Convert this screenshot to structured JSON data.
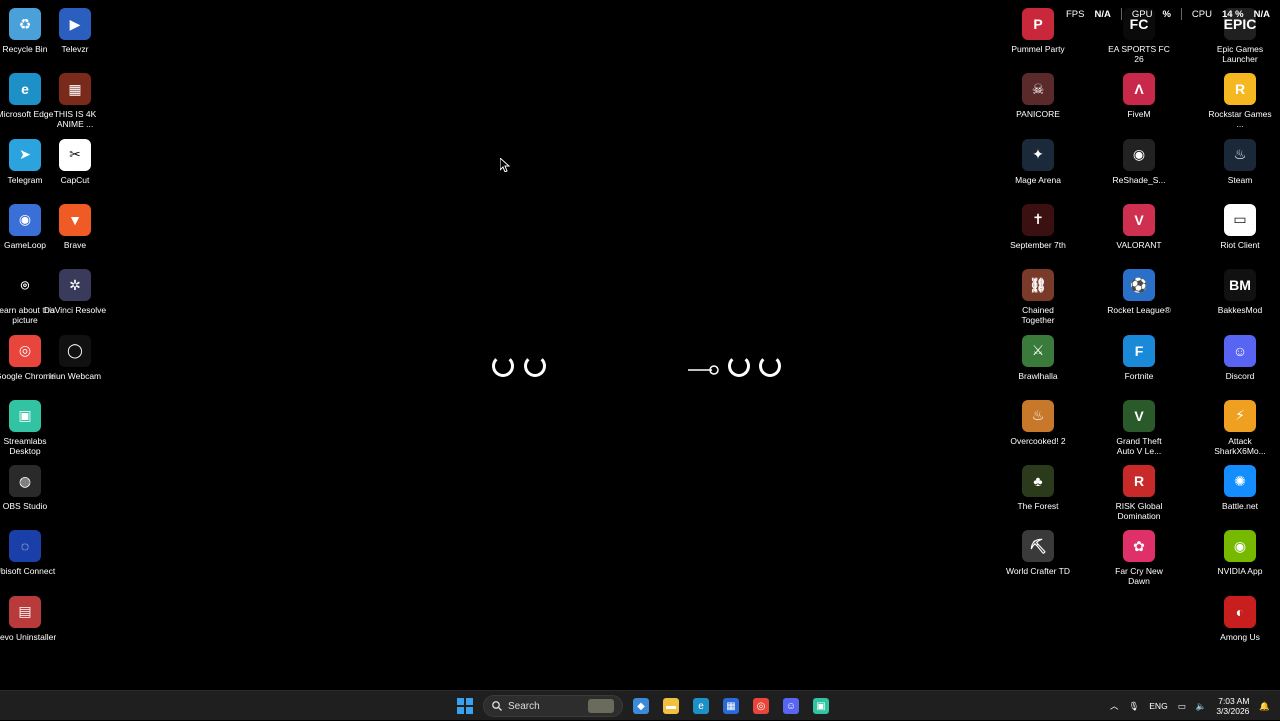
{
  "desktop": {
    "left_icons": [
      {
        "name": "recycle-bin",
        "label": "Recycle Bin",
        "color": "#4aa0d8",
        "glyph": "♻"
      },
      {
        "name": "televzr",
        "label": "Televzr",
        "color": "#2a5fbf",
        "glyph": "▶"
      },
      {
        "name": "microsoft-edge",
        "label": "Microsoft Edge",
        "color": "#1e90c8",
        "glyph": "e"
      },
      {
        "name": "this-is-4k-anime",
        "label": "THIS IS 4K ANIME ...",
        "color": "#7a2a1a",
        "glyph": "▦"
      },
      {
        "name": "telegram",
        "label": "Telegram",
        "color": "#2aa3df",
        "glyph": "➤"
      },
      {
        "name": "capcut",
        "label": "CapCut",
        "color": "#ffffff",
        "glyph": "✂"
      },
      {
        "name": "gameloop",
        "label": "GameLoop",
        "color": "#3a6fd8",
        "glyph": "◉"
      },
      {
        "name": "brave",
        "label": "Brave",
        "color": "#f05a24",
        "glyph": "▼"
      },
      {
        "name": "learn-about-picture",
        "label": "Learn about this picture",
        "color": "#000000",
        "glyph": "⌾"
      },
      {
        "name": "davinci-resolve",
        "label": "DaVinci Resolve",
        "color": "#3a3a5a",
        "glyph": "✲"
      },
      {
        "name": "google-chrome",
        "label": "Google Chrome",
        "color": "#e8453c",
        "glyph": "◎"
      },
      {
        "name": "iriun-webcam",
        "label": "Iriun Webcam",
        "color": "#111111",
        "glyph": "◯"
      },
      {
        "name": "streamlabs-desktop",
        "label": "Streamlabs Desktop",
        "color": "#31c3a2",
        "glyph": "▣"
      },
      {
        "name": "obs-studio",
        "label": "OBS Studio",
        "color": "#2a2a2a",
        "glyph": "◍"
      },
      {
        "name": "ubisoft-connect",
        "label": "Ubisoft Connect",
        "color": "#1a3fa8",
        "glyph": "◌"
      },
      {
        "name": "revo-uninstaller",
        "label": "Revo Uninstaller",
        "color": "#b83a3a",
        "glyph": "▤"
      }
    ],
    "right_icons": [
      {
        "name": "pummel-party",
        "label": "Pummel Party",
        "color": "#c8283a",
        "glyph": "P"
      },
      {
        "name": "ea-sports-fc-26",
        "label": "EA SPORTS FC 26",
        "color": "#0a0a0a",
        "glyph": "FC"
      },
      {
        "name": "epic-games-launcher",
        "label": "Epic Games Launcher",
        "color": "#202020",
        "glyph": "EPIC"
      },
      {
        "name": "panicore",
        "label": "PANICORE",
        "color": "#5a2a2a",
        "glyph": "☠"
      },
      {
        "name": "fivem",
        "label": "FiveM",
        "color": "#c8284a",
        "glyph": "Λ"
      },
      {
        "name": "rockstar-games",
        "label": "Rockstar Games ...",
        "color": "#f6b820",
        "glyph": "R"
      },
      {
        "name": "mage-arena",
        "label": "Mage Arena",
        "color": "#1a2a3a",
        "glyph": "✦"
      },
      {
        "name": "reshade",
        "label": "ReShade_S...",
        "color": "#222222",
        "glyph": "◉"
      },
      {
        "name": "steam",
        "label": "Steam",
        "color": "#1b2838",
        "glyph": "♨"
      },
      {
        "name": "september-7th",
        "label": "September 7th",
        "color": "#3a1010",
        "glyph": "✝"
      },
      {
        "name": "valorant",
        "label": "VALORANT",
        "color": "#d03050",
        "glyph": "V"
      },
      {
        "name": "riot-client",
        "label": "Riot Client",
        "color": "#ffffff",
        "glyph": "▭"
      },
      {
        "name": "chained-together",
        "label": "Chained Together",
        "color": "#7a3a2a",
        "glyph": "⛓"
      },
      {
        "name": "rocket-league",
        "label": "Rocket League®",
        "color": "#2a70c8",
        "glyph": "⚽"
      },
      {
        "name": "bakkesmod",
        "label": "BakkesMod",
        "color": "#111111",
        "glyph": "BM"
      },
      {
        "name": "brawlhalla",
        "label": "Brawlhalla",
        "color": "#3a7a3a",
        "glyph": "⚔"
      },
      {
        "name": "fortnite",
        "label": "Fortnite",
        "color": "#1a8ad8",
        "glyph": "F"
      },
      {
        "name": "discord",
        "label": "Discord",
        "color": "#5865f2",
        "glyph": "☺"
      },
      {
        "name": "overcooked-2",
        "label": "Overcooked! 2",
        "color": "#c8782a",
        "glyph": "♨"
      },
      {
        "name": "gta-v",
        "label": "Grand Theft Auto V Le...",
        "color": "#2a5a2a",
        "glyph": "V"
      },
      {
        "name": "attack-shark",
        "label": "Attack SharkX6Mo...",
        "color": "#f0a020",
        "glyph": "⚡"
      },
      {
        "name": "the-forest",
        "label": "The Forest",
        "color": "#2a3a1a",
        "glyph": "♣"
      },
      {
        "name": "risk-global-domination",
        "label": "RISK Global Domination",
        "color": "#c82a2a",
        "glyph": "R"
      },
      {
        "name": "battle-net",
        "label": "Battle.net",
        "color": "#148eff",
        "glyph": "✺"
      },
      {
        "name": "world-crafter-td",
        "label": "World Crafter TD",
        "color": "#3a3a3a",
        "glyph": "⛏"
      },
      {
        "name": "far-cry-new-dawn",
        "label": "Far Cry New Dawn",
        "color": "#e0306a",
        "glyph": "✿"
      },
      {
        "name": "nvidia-app",
        "label": "NVIDIA App",
        "color": "#76b900",
        "glyph": "◉"
      },
      {
        "name": "among-us",
        "label": "Among Us",
        "color": "#c81e1e",
        "glyph": "◐"
      }
    ]
  },
  "overlay": {
    "fps_label": "FPS",
    "fps_value": "N/A",
    "gpu_label": "GPU",
    "gpu_value": "%",
    "cpu_label": "CPU",
    "cpu_value": "14 %",
    "extra_value": "N/A"
  },
  "taskbar": {
    "search_placeholder": "Search",
    "apps": [
      {
        "name": "copilot",
        "color": "#3a8ad8",
        "glyph": "◆"
      },
      {
        "name": "file-explorer",
        "color": "#f0c040",
        "glyph": "▬"
      },
      {
        "name": "edge",
        "color": "#1e90c8",
        "glyph": "e"
      },
      {
        "name": "microsoft-store",
        "color": "#2a6ad8",
        "glyph": "▦"
      },
      {
        "name": "chrome",
        "color": "#e8453c",
        "glyph": "◎"
      },
      {
        "name": "discord",
        "color": "#5865f2",
        "glyph": "☺"
      },
      {
        "name": "streamlabs",
        "color": "#31c3a2",
        "glyph": "▣"
      }
    ],
    "language": "ENG",
    "time": "7:03 AM",
    "date": "3/3/2026"
  }
}
